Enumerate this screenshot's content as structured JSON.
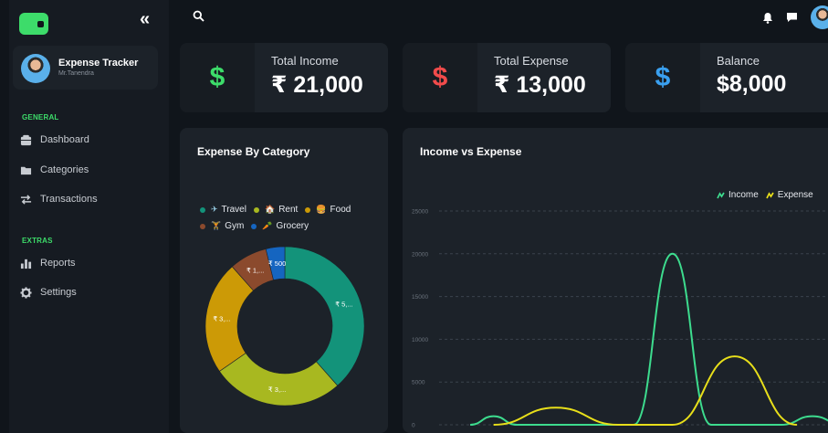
{
  "app": {
    "profile_name": "Expense Tracker",
    "profile_user": "Mr.Tanendra"
  },
  "sidebar": {
    "collapse_icon": "«",
    "general_label": "GENERAL",
    "extras_label": "EXTRAS",
    "items": [
      {
        "label": "Dashboard",
        "icon": "dashboard-icon"
      },
      {
        "label": "Categories",
        "icon": "folder-icon"
      },
      {
        "label": "Transactions",
        "icon": "transfer-icon"
      },
      {
        "label": "Reports",
        "icon": "bar-chart-icon"
      },
      {
        "label": "Settings",
        "icon": "gear-icon"
      }
    ]
  },
  "cards": [
    {
      "label": "Total Income",
      "value": "₹ 21,000",
      "symbol": "$",
      "color": "#3ddc6a"
    },
    {
      "label": "Total Expense",
      "value": "₹ 13,000",
      "symbol": "$",
      "color": "#f24b4b"
    },
    {
      "label": "Balance",
      "value": "$8,000",
      "symbol": "$",
      "color": "#3aa0f0"
    }
  ],
  "category_panel": {
    "title": "Expense By Category",
    "legend": [
      {
        "name": "Travel",
        "emoji": "✈",
        "color": "#13937a"
      },
      {
        "name": "Rent",
        "emoji": "🏠",
        "color": "#a8b820"
      },
      {
        "name": "Food",
        "emoji": "🍔",
        "color": "#cc9a06"
      },
      {
        "name": "Gym",
        "emoji": "🏋",
        "color": "#8b4a2d"
      },
      {
        "name": "Grocery",
        "emoji": "🥕",
        "color": "#1565c0"
      }
    ]
  },
  "trend_panel": {
    "title": "Income vs Expense",
    "legend_income": "Income",
    "legend_expense": "Expense"
  },
  "chart_data": [
    {
      "type": "pie",
      "title": "Expense By Category",
      "categories": [
        "Travel",
        "Rent",
        "Food",
        "Gym",
        "Grocery"
      ],
      "values": [
        5000,
        3500,
        3000,
        1000,
        500
      ],
      "data_labels": [
        "₹ 5,...",
        "₹ 3,...",
        "₹ 3,...",
        "₹ 1,...",
        "₹ 500"
      ],
      "colors": [
        "#13937a",
        "#a8b820",
        "#cc9a06",
        "#8b4a2d",
        "#1565c0"
      ],
      "donut": true,
      "legend_position": "top"
    },
    {
      "type": "line",
      "title": "Income vs Expense",
      "ylim": [
        0,
        25000
      ],
      "yticks": [
        0,
        5000,
        10000,
        15000,
        20000,
        25000
      ],
      "grid": true,
      "legend_position": "top-right",
      "series": [
        {
          "name": "Income",
          "color": "#3ddc8e",
          "points": [
            [
              0.08,
              0
            ],
            [
              0.14,
              1000
            ],
            [
              0.2,
              0
            ],
            [
              0.5,
              0
            ],
            [
              0.6,
              20000
            ],
            [
              0.7,
              0
            ],
            [
              0.88,
              0
            ],
            [
              0.96,
              1000
            ],
            [
              1.04,
              0
            ]
          ]
        },
        {
          "name": "Expense",
          "color": "#e8df1a",
          "points": [
            [
              0.14,
              0
            ],
            [
              0.3,
              2000
            ],
            [
              0.46,
              0
            ],
            [
              0.6,
              0
            ],
            [
              0.76,
              8000
            ],
            [
              0.92,
              0
            ]
          ]
        }
      ]
    }
  ]
}
